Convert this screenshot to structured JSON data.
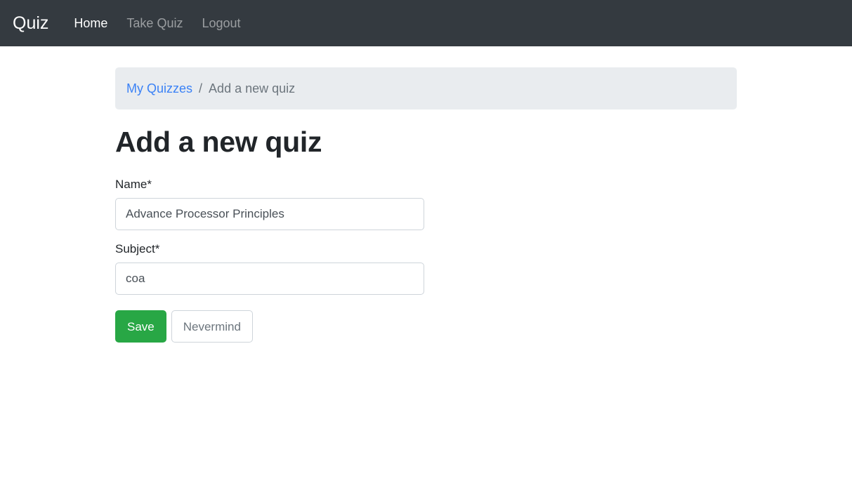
{
  "navbar": {
    "brand": "Quiz",
    "links": [
      {
        "label": "Home",
        "state": "active"
      },
      {
        "label": "Take Quiz",
        "state": "muted"
      },
      {
        "label": "Logout",
        "state": "muted"
      }
    ],
    "background_color": "#343a40"
  },
  "breadcrumb": {
    "parent_label": "My Quizzes",
    "separator": "/",
    "current_label": "Add a new quiz",
    "background_color": "#e9ecef",
    "link_color": "#3b82f6"
  },
  "main": {
    "page_title": "Add a new quiz",
    "form": {
      "fields": [
        {
          "label": "Name*",
          "value": "Advance Processor Principles",
          "placeholder": "Advance Processor Principles"
        },
        {
          "label": "Subject*",
          "value": "coa",
          "placeholder": "coa"
        }
      ],
      "buttons": {
        "save_label": "Save",
        "save_color": "#28a745",
        "cancel_label": "Nevermind",
        "cancel_color": "#6c757d"
      }
    }
  }
}
